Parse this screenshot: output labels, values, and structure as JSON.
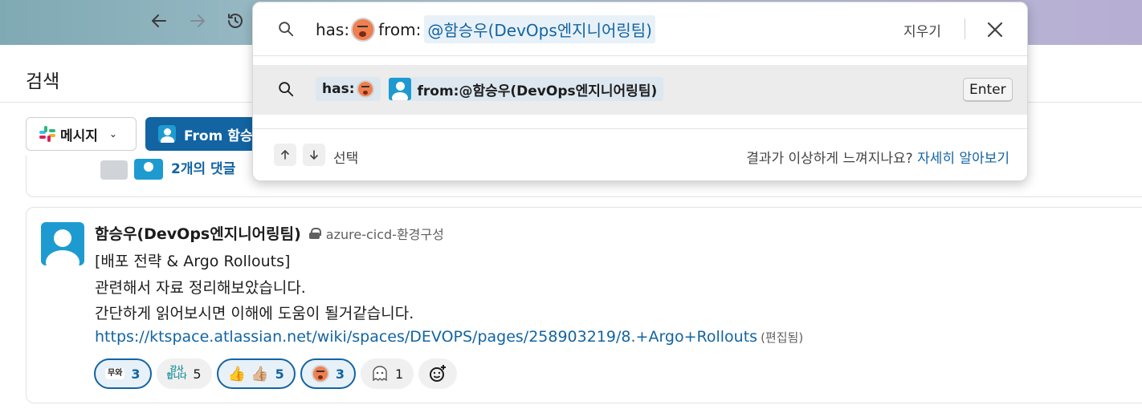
{
  "browser": {
    "back_icon": "arrow-left-icon",
    "forward_icon": "arrow-right-icon",
    "history_icon": "history-icon"
  },
  "page": {
    "title": "검색"
  },
  "filters": {
    "messages_label": "메시지",
    "from_label": "From 함승우"
  },
  "prev_result": {
    "replies": "2개의 댓글"
  },
  "result": {
    "author": "함승우(DevOps엔지니어링팀)",
    "channel": "azure-cicd-환경구성",
    "lines": [
      "[배포 전략 & Argo Rollouts]",
      "관련해서 자료 정리해보았습니다.",
      "간단하게 읽어보시면 이해에 도움이 될거같습니다."
    ],
    "link": "https://ktspace.atlassian.net/wiki/spaces/DEVOPS/pages/258903219/8.+Argo+Rollouts",
    "edited": "(편집됨)",
    "reactions": [
      {
        "emoji_text": "무와",
        "count": "3",
        "active": true
      },
      {
        "emoji_text_top": "감사",
        "emoji_text_bottom": "합니다",
        "count": "5",
        "active": false
      },
      {
        "emoji": "👍 👍🏼",
        "count": "5",
        "active": true
      },
      {
        "emoji_icon": "face-emoji",
        "count": "3",
        "active": true
      },
      {
        "emoji_icon": "ghost-emoji",
        "count": "1",
        "active": false
      }
    ],
    "add_reaction_icon": "add-reaction-icon"
  },
  "search": {
    "query_prefix": "has:",
    "query_from": "from:",
    "query_token": "@함승우(DevOps엔지니어링팀)",
    "clear_label": "지우기",
    "suggestion_has": "has:",
    "suggestion_from": "from:@함승우(DevOps엔지니어링팀)",
    "enter_label": "Enter",
    "select_label": "선택",
    "help_text": "결과가 이상하게 느껴지나요?",
    "help_link": "자세히 알아보기"
  },
  "colors": {
    "accent": "#1264a3",
    "avatar": "#1d9bd1"
  }
}
